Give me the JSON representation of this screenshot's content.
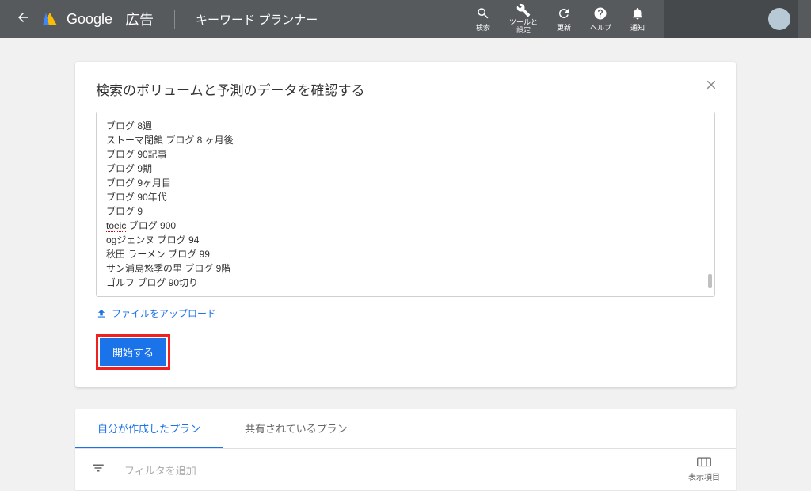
{
  "header": {
    "brand": "Google",
    "brand_product": "広告",
    "page_title": "キーワード プランナー",
    "icons": {
      "search": "検索",
      "tools": "ツールと\n設定",
      "refresh": "更新",
      "help": "ヘルプ",
      "notifications": "通知"
    }
  },
  "card": {
    "title": "検索のボリュームと予測のデータを確認する",
    "keywords": [
      "ブログ 8週",
      "ストーマ閉鎖 ブログ 8 ヶ月後",
      "ブログ 90記事",
      "ブログ 9期",
      "ブログ 9ヶ月目",
      "ブログ 90年代",
      "ブログ 9",
      "toeic ブログ 900",
      "ogジェンヌ ブログ 94",
      "秋田 ラーメン ブログ 99",
      "サン浦島悠季の里 ブログ 9階",
      "ゴルフ ブログ 90切り"
    ],
    "upload_label": "ファイルをアップロード",
    "start_label": "開始する"
  },
  "plans": {
    "tab_mine": "自分が作成したプラン",
    "tab_shared": "共有されているプラン",
    "filter_placeholder": "フィルタを追加",
    "columns_label": "表示項目"
  }
}
